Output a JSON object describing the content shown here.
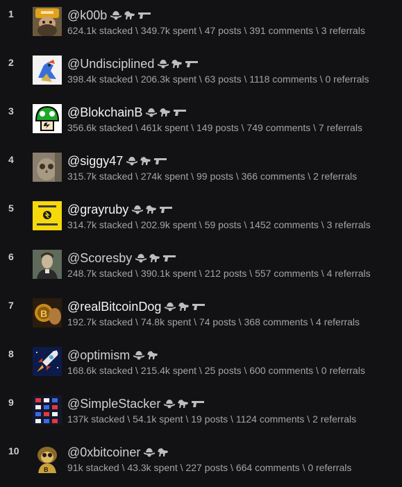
{
  "users": [
    {
      "rank": "1",
      "name": "@k00b",
      "visited": true,
      "badges": [
        "cowboy-hat",
        "horse",
        "gun"
      ],
      "stacked": "624.1k stacked",
      "spent": "349.7k spent",
      "posts": "47 posts",
      "comments": "391 comments",
      "referrals": "3 referrals",
      "avatar": "hat-man-avatar"
    },
    {
      "rank": "2",
      "name": "@Undisciplined",
      "visited": true,
      "badges": [
        "cowboy-hat",
        "horse",
        "gun"
      ],
      "stacked": "398.4k stacked",
      "spent": "206.3k spent",
      "posts": "63 posts",
      "comments": "1118 comments",
      "referrals": "0 referrals",
      "avatar": "cartoon-bird-avatar"
    },
    {
      "rank": "3",
      "name": "@BlokchainB",
      "visited": false,
      "badges": [
        "cowboy-hat",
        "horse",
        "gun"
      ],
      "stacked": "356.6k stacked",
      "spent": "461k spent",
      "posts": "149 posts",
      "comments": "749 comments",
      "referrals": "7 referrals",
      "avatar": "green-mushroom-avatar"
    },
    {
      "rank": "4",
      "name": "@siggy47",
      "visited": false,
      "badges": [
        "cowboy-hat",
        "horse",
        "gun"
      ],
      "stacked": "315.7k stacked",
      "spent": "274k spent",
      "posts": "99 posts",
      "comments": "366 comments",
      "referrals": "2 referrals",
      "avatar": "owl-photo-avatar"
    },
    {
      "rank": "5",
      "name": "@grayruby",
      "visited": false,
      "badges": [
        "cowboy-hat",
        "horse",
        "gun"
      ],
      "stacked": "314.7k stacked",
      "spent": "202.9k spent",
      "posts": "59 posts",
      "comments": "1452 comments",
      "referrals": "3 referrals",
      "avatar": "yellow-sign-avatar"
    },
    {
      "rank": "6",
      "name": "@Scoresby",
      "visited": true,
      "badges": [
        "cowboy-hat",
        "horse",
        "gun"
      ],
      "stacked": "248.7k stacked",
      "spent": "390.1k spent",
      "posts": "212 posts",
      "comments": "557 comments",
      "referrals": "4 referrals",
      "avatar": "portrait-avatar"
    },
    {
      "rank": "7",
      "name": "@realBitcoinDog",
      "visited": false,
      "badges": [
        "cowboy-hat",
        "horse",
        "gun"
      ],
      "stacked": "192.7k stacked",
      "spent": "74.8k spent",
      "posts": "74 posts",
      "comments": "368 comments",
      "referrals": "4 referrals",
      "avatar": "bitcoin-dog-avatar"
    },
    {
      "rank": "8",
      "name": "@optimism",
      "visited": true,
      "badges": [
        "cowboy-hat",
        "horse"
      ],
      "stacked": "168.6k stacked",
      "spent": "215.4k spent",
      "posts": "25 posts",
      "comments": "600 comments",
      "referrals": "0 referrals",
      "avatar": "rocket-avatar"
    },
    {
      "rank": "9",
      "name": "@SimpleStacker",
      "visited": true,
      "badges": [
        "cowboy-hat",
        "horse",
        "gun"
      ],
      "stacked": "137k stacked",
      "spent": "54.1k spent",
      "posts": "19 posts",
      "comments": "1124 comments",
      "referrals": "2 referrals",
      "avatar": "grid-avatar"
    },
    {
      "rank": "10",
      "name": "@0xbitcoiner",
      "visited": true,
      "badges": [
        "cowboy-hat",
        "horse"
      ],
      "stacked": "91k stacked",
      "spent": "43.3k spent",
      "posts": "227 posts",
      "comments": "664 comments",
      "referrals": "0 referrals",
      "avatar": "monkey-avatar"
    }
  ],
  "separator": " \\ ",
  "colors": {
    "background": "#121214",
    "name_visited": "#d0d0d0",
    "name_bright": "#f4f4f4",
    "stats": "#a4a4a4",
    "badge": "#bdbdbd"
  }
}
